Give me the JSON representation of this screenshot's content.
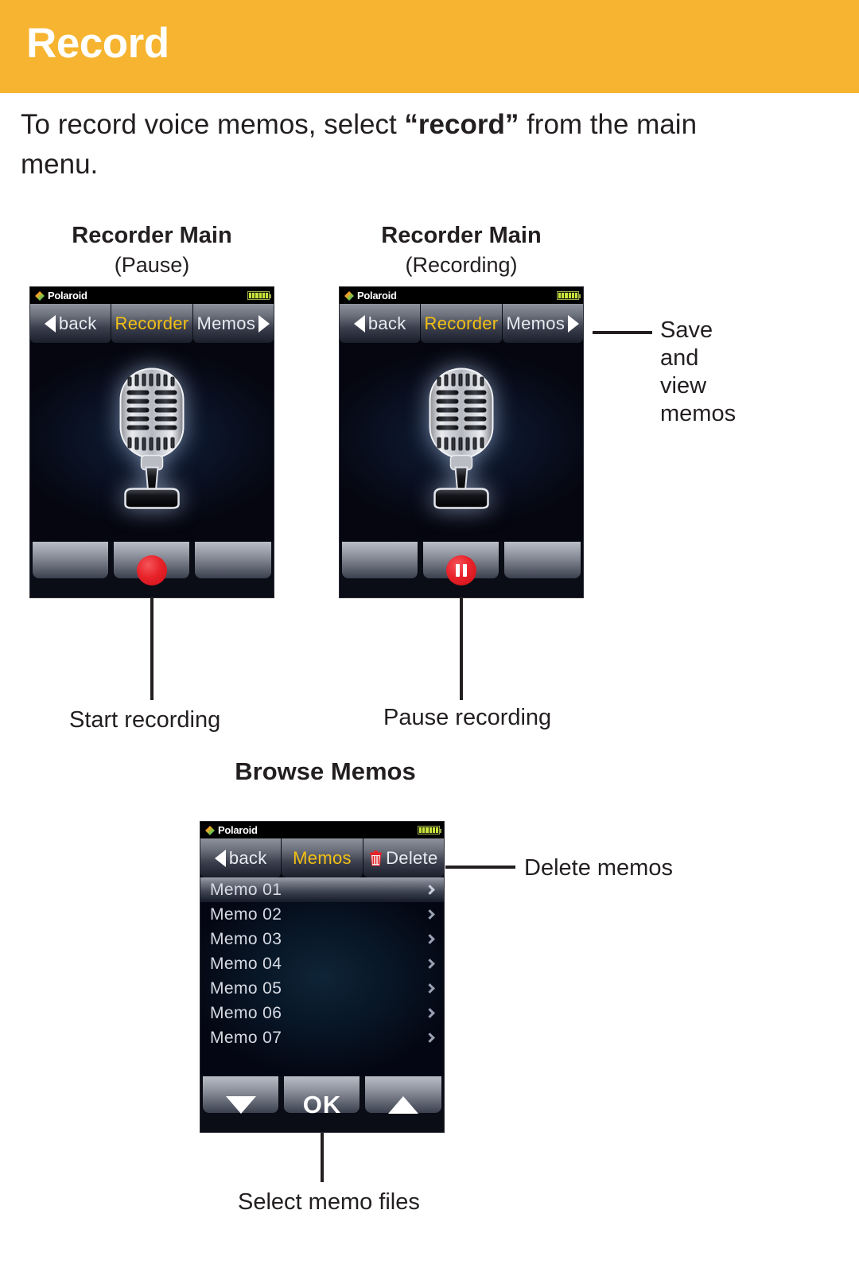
{
  "header": {
    "title": "Record",
    "bg_color": "#f6b430"
  },
  "intro": {
    "part1": "To record voice memos, select ",
    "quoted": "“record”",
    "part2": " from the main menu."
  },
  "sections": {
    "pause": {
      "title": "Recorder Main",
      "subtitle": "(Pause)"
    },
    "recording": {
      "title": "Recorder Main",
      "subtitle": "(Recording)"
    },
    "browse": {
      "title": "Browse Memos"
    }
  },
  "device": {
    "brand": "Polaroid",
    "battery_segments": 6,
    "battery_color": "#c8e33a",
    "accent_color": "#f2c013"
  },
  "toolbar_recorder": {
    "back_label": "back",
    "title_label": "Recorder",
    "memos_label": "Memos"
  },
  "toolbar_memos": {
    "back_label": "back",
    "title_label": "Memos",
    "delete_label": "Delete"
  },
  "memo_list": {
    "items": [
      {
        "label": "Memo 01",
        "selected": true
      },
      {
        "label": "Memo 02",
        "selected": false
      },
      {
        "label": "Memo 03",
        "selected": false
      },
      {
        "label": "Memo 04",
        "selected": false
      },
      {
        "label": "Memo 05",
        "selected": false
      },
      {
        "label": "Memo 06",
        "selected": false
      },
      {
        "label": "Memo 07",
        "selected": false
      }
    ]
  },
  "memo_controls": {
    "down_label": "down-arrow",
    "ok_label": "OK",
    "up_label": "up-arrow"
  },
  "annotations": {
    "save_view_memos": [
      "Save",
      "and",
      "view",
      "memos"
    ],
    "start_recording": "Start recording",
    "pause_recording": "Pause recording",
    "delete_memos": "Delete memos",
    "select_memo_files": "Select memo files"
  },
  "icons": {
    "record": "record-dot-icon",
    "pause": "pause-icon",
    "trash": "trash-icon",
    "back_arrow": "left-triangle-icon",
    "forward_arrow": "right-triangle-icon",
    "microphone": "microphone-icon",
    "polaroid_logo": "polaroid-diamond-icon",
    "battery": "battery-icon"
  }
}
